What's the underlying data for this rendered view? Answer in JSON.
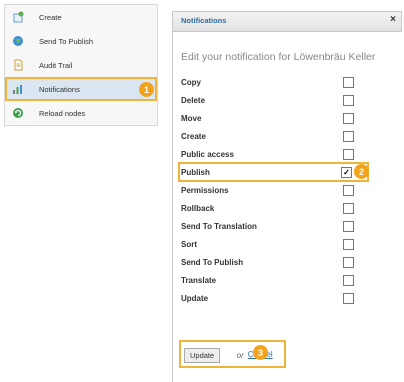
{
  "context_menu": {
    "items": [
      {
        "label": "Create",
        "icon": "create-icon"
      },
      {
        "label": "Send To Publish",
        "icon": "globe-icon"
      },
      {
        "label": "Audit Trail",
        "icon": "document-icon"
      },
      {
        "label": "Notifications",
        "icon": "chart-icon",
        "active": true
      },
      {
        "label": "Reload nodes",
        "icon": "refresh-icon"
      }
    ],
    "callout": "1"
  },
  "panel": {
    "title": "Notifications",
    "close": "×",
    "subtitle": "Edit your notification for Löwenbräu Keller",
    "options": [
      {
        "label": "Copy",
        "checked": false
      },
      {
        "label": "Delete",
        "checked": false
      },
      {
        "label": "Move",
        "checked": false
      },
      {
        "label": "Create",
        "checked": false
      },
      {
        "label": "Public access",
        "checked": false
      },
      {
        "label": "Publish",
        "checked": true
      },
      {
        "label": "Permissions",
        "checked": false
      },
      {
        "label": "Rollback",
        "checked": false
      },
      {
        "label": "Send To Translation",
        "checked": false
      },
      {
        "label": "Sort",
        "checked": false
      },
      {
        "label": "Send To Publish",
        "checked": false
      },
      {
        "label": "Translate",
        "checked": false
      },
      {
        "label": "Update",
        "checked": false
      }
    ],
    "callout": "2",
    "footer": {
      "update_label": "Update",
      "or_text": "or",
      "cancel_label": "Cancel",
      "callout": "3"
    }
  },
  "colors": {
    "accent": "#2e6da4",
    "highlight": "#f0b43a",
    "callout": "#f2a31b"
  }
}
